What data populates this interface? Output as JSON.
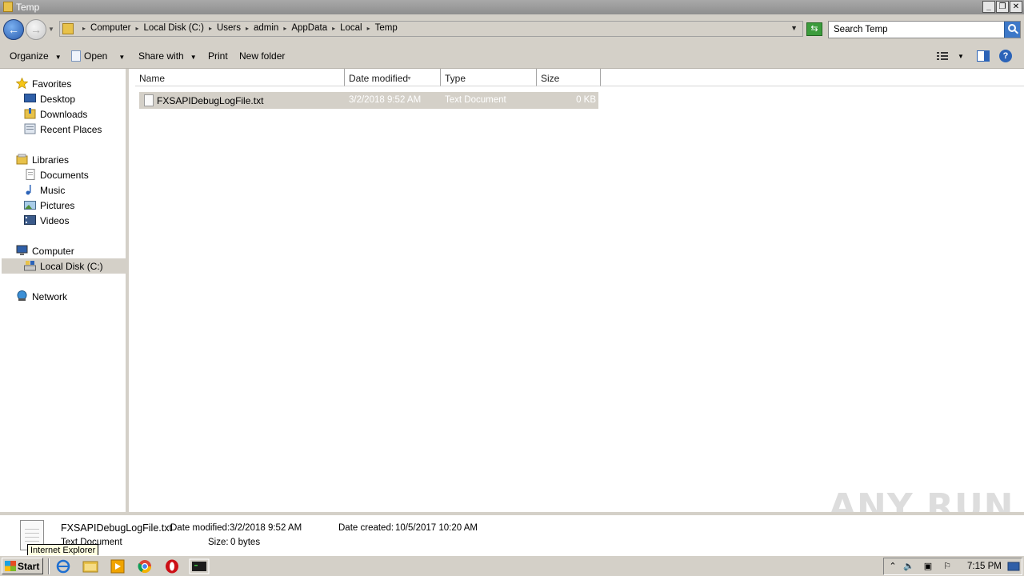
{
  "window": {
    "title": "Temp"
  },
  "address": {
    "crumbs": [
      "Computer",
      "Local Disk (C:)",
      "Users",
      "admin",
      "AppData",
      "Local",
      "Temp"
    ]
  },
  "search": {
    "placeholder": "Search Temp"
  },
  "toolbar": {
    "organize": "Organize",
    "open": "Open",
    "share_with": "Share with",
    "print": "Print",
    "new_folder": "New folder"
  },
  "nav": {
    "favorites": "Favorites",
    "desktop": "Desktop",
    "downloads": "Downloads",
    "recent_places": "Recent Places",
    "libraries": "Libraries",
    "documents": "Documents",
    "music": "Music",
    "pictures": "Pictures",
    "videos": "Videos",
    "computer": "Computer",
    "local_disk": "Local Disk (C:)",
    "network": "Network"
  },
  "columns": {
    "name": "Name",
    "date_modified": "Date modified",
    "type": "Type",
    "size": "Size"
  },
  "files": [
    {
      "name": "FXSAPIDebugLogFile.txt",
      "date": "3/2/2018 9:52 AM",
      "type": "Text Document",
      "size": "0 KB"
    }
  ],
  "details": {
    "name": "FXSAPIDebugLogFile.txt",
    "type": "Text Document",
    "date_modified_label": "Date modified:",
    "date_modified": "3/2/2018 9:52 AM",
    "date_created_label": "Date created:",
    "date_created": "10/5/2017 10:20 AM",
    "size_label": "Size:",
    "size": "0 bytes"
  },
  "tooltip": "Internet Explorer",
  "watermark": "ANY RUN",
  "taskbar": {
    "start": "Start",
    "clock": "7:15 PM"
  }
}
